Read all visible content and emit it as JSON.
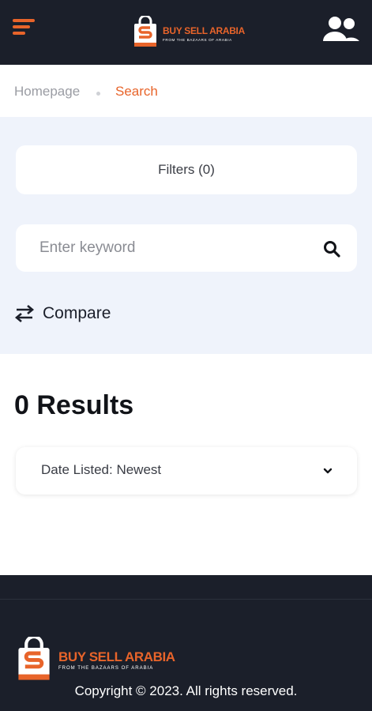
{
  "header": {
    "logo_name": "BUY SELL ARABIA",
    "logo_tagline": "FROM THE BAZAARS OF ARABIA",
    "menu_icon": "hamburger-menu-icon",
    "account_icon": "users-icon"
  },
  "breadcrumb": {
    "home": "Homepage",
    "current": "Search"
  },
  "search": {
    "filters_label": "Filters (0)",
    "placeholder": "Enter keyword",
    "compare_label": "Compare"
  },
  "results": {
    "title": "0 Results",
    "sort_value": "Date Listed: Newest"
  },
  "footer": {
    "logo_name": "BUY SELL ARABIA",
    "logo_tagline": "FROM THE BAZAARS OF ARABIA",
    "copyright": "Copyright © 2023. All rights reserved."
  },
  "colors": {
    "accent": "#e8642a",
    "dark": "#1b1f2a",
    "panel": "#eff3fb"
  }
}
